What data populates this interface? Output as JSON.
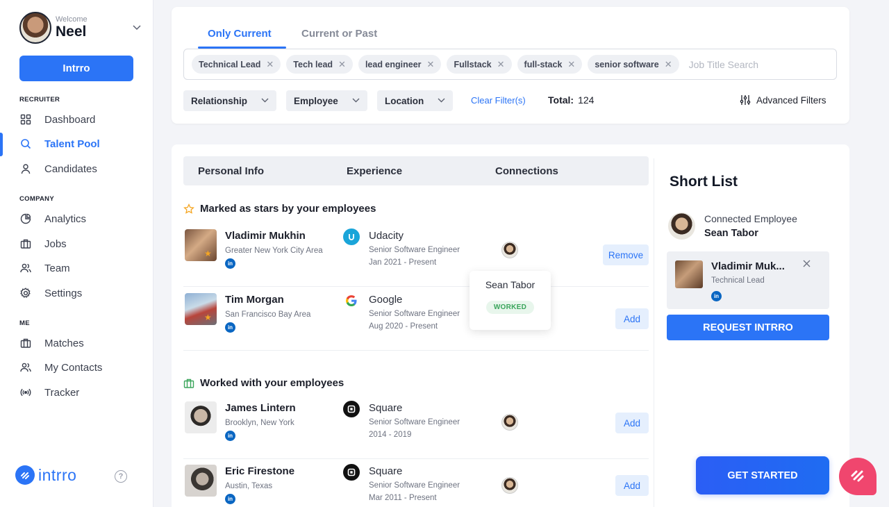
{
  "sidebar": {
    "welcome": "Welcome",
    "username": "Neel",
    "intrro_button": "Intrro",
    "sections": {
      "recruiter": "RECRUITER",
      "company": "COMPANY",
      "me": "ME"
    },
    "items": [
      {
        "label": "Dashboard",
        "icon": "grid-icon"
      },
      {
        "label": "Talent Pool",
        "icon": "search-icon",
        "active": true
      },
      {
        "label": "Candidates",
        "icon": "user-icon"
      },
      {
        "label": "Analytics",
        "icon": "pie-chart-icon"
      },
      {
        "label": "Jobs",
        "icon": "briefcase-icon"
      },
      {
        "label": "Team",
        "icon": "users-icon"
      },
      {
        "label": "Settings",
        "icon": "gear-icon"
      },
      {
        "label": "Matches",
        "icon": "briefcase-icon"
      },
      {
        "label": "My Contacts",
        "icon": "users-icon"
      },
      {
        "label": "Tracker",
        "icon": "broadcast-icon"
      }
    ],
    "logo_text": "intrro",
    "help": "?"
  },
  "filters": {
    "tabs": [
      "Only Current",
      "Current or Past"
    ],
    "chips": [
      "Technical Lead",
      "Tech lead",
      "lead engineer",
      "Fullstack",
      "full-stack",
      "senior software"
    ],
    "search_placeholder": "Job Title Search",
    "dropdowns": [
      "Relationship",
      "Employee",
      "Location"
    ],
    "clear_label": "Clear Filter(s)",
    "total_label": "Total:",
    "total_value": "124",
    "advanced_label": "Advanced Filters"
  },
  "table": {
    "headers": [
      "Personal Info",
      "Experience",
      "Connections"
    ],
    "sections": [
      "Marked as stars by your employees",
      "Worked with your employees"
    ],
    "rows": [
      {
        "name": "Vladimir Mukhin",
        "location": "Greater New York City Area",
        "company": "Udacity",
        "title": "Senior Software Engineer",
        "dates": "Jan 2021 - Present",
        "action": "Remove",
        "starred": true
      },
      {
        "name": "Tim Morgan",
        "location": "San Francisco Bay Area",
        "company": "Google",
        "title": "Senior Software Engineer",
        "dates": "Aug 2020 - Present",
        "action": "Add",
        "starred": true
      },
      {
        "name": "James Lintern",
        "location": "Brooklyn, New York",
        "company": "Square",
        "title": "Senior Software Engineer",
        "dates": "2014 - 2019",
        "action": "Add",
        "starred": false
      },
      {
        "name": "Eric Firestone",
        "location": "Austin, Texas",
        "company": "Square",
        "title": "Senior Software Engineer",
        "dates": "Mar 2011 - Present",
        "action": "Add",
        "starred": false
      }
    ],
    "linkedin": "in"
  },
  "tooltip": {
    "name": "Sean Tabor",
    "badge": "WORKED"
  },
  "shortlist": {
    "title": "Short List",
    "connected_label": "Connected Employee",
    "connected_name": "Sean Tabor",
    "candidate_name": "Vladimir Muk...",
    "candidate_role": "Technical Lead",
    "request_button": "REQUEST INTRRO"
  },
  "cta": {
    "get_started": "GET STARTED"
  },
  "colors": {
    "accent": "#2b74f6",
    "star": "#f5a623",
    "linkedin": "#0a66c2",
    "worked_badge": "#3aa55b",
    "fab": "#f0466e"
  }
}
